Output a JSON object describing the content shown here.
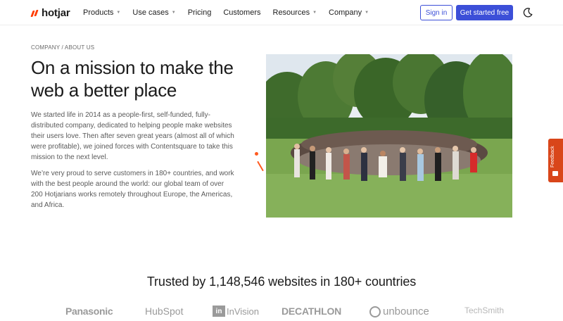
{
  "nav": {
    "logo_text": "hotjar",
    "brand_color": "#ff3c00",
    "links": [
      {
        "label": "Products",
        "dropdown": true
      },
      {
        "label": "Use cases",
        "dropdown": true
      },
      {
        "label": "Pricing",
        "dropdown": false
      },
      {
        "label": "Customers",
        "dropdown": false
      },
      {
        "label": "Resources",
        "dropdown": true
      },
      {
        "label": "Company",
        "dropdown": true
      }
    ],
    "signin_label": "Sign in",
    "cta_label": "Get started free",
    "accent_color": "#3c4fd8",
    "theme_icon": "moon-icon"
  },
  "hero": {
    "breadcrumb": "COMPANY / ABOUT US",
    "title": "On a mission to make the web a better place",
    "paragraph_1": "We started life in 2014 as a people-first, self-funded, fully-distributed company, dedicated to helping people make websites their users love. Then after seven great years (almost all of which were profitable), we joined forces with Contentsquare to take this mission to the next level.",
    "paragraph_2": "We’re very proud to serve customers in 180+ countries, and work with the best people around the world: our global team of over 200 Hotjarians works remotely throughout Europe, the Americas, and Africa.",
    "photo_description_icon": "team-photo"
  },
  "feedback_tab": {
    "label": "Feedback",
    "color": "#d9461a"
  },
  "trusted": {
    "heading": "Trusted by 1,148,546 websites in 180+ countries",
    "logos": [
      "Panasonic",
      "HubSpot",
      "InVision",
      "DECATHLON",
      "unbounce",
      "TechSmith"
    ]
  }
}
